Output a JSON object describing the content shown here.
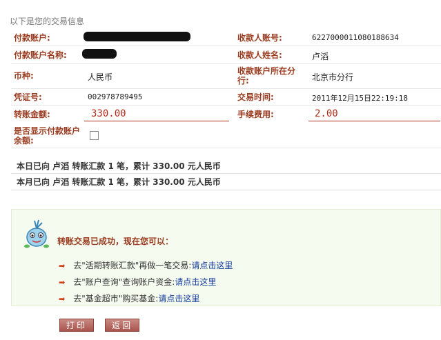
{
  "header": {
    "title": "以下是您的交易信息"
  },
  "fields": {
    "payer_account_label": "付款账户:",
    "payer_name_label": "付款账户名称:",
    "currency_label": "币种:",
    "currency_value": "人民币",
    "voucher_label": "凭证号:",
    "voucher_value": "002978789495",
    "amount_label": "转账金额:",
    "amount_value": "330.00",
    "show_balance_label": "是否显示付款账户余额:",
    "payee_account_label": "收款人账号:",
    "payee_account_value": "6227000011080188634",
    "payee_name_label": "收款人姓名:",
    "payee_name_value": "卢滔",
    "payee_branch_label": "收款账户所在分行:",
    "payee_branch_value": "北京市分行",
    "time_label": "交易时间:",
    "time_value": "2011年12月15日22:19:18",
    "fee_label": "手续费用:",
    "fee_value": "2.00"
  },
  "summary": {
    "today": "本日已向 卢滔 转账汇款 1 笔，累计 330.00 元人民币",
    "month": "本月已向 卢滔 转账汇款 1 笔，累计 330.00 元人民币"
  },
  "success": {
    "title": "转账交易已成功，现在您可以：",
    "options": [
      {
        "prefix": "去\"活期转账汇款\"再做一笔交易:",
        "link": "请点击这里"
      },
      {
        "prefix": "去\"账户查询\"查询账户资金:",
        "link": "请点击这里"
      },
      {
        "prefix": "去\"基金超市\"购买基金:",
        "link": "请点击这里"
      }
    ]
  },
  "buttons": {
    "print": "打印",
    "back": "返回"
  },
  "colors": {
    "label": "#9a3b1f",
    "amount": "#b02a1a",
    "link": "#103a9c",
    "arrow": "#d23a12"
  },
  "icons": {
    "option_arrow": "arrow-right-icon",
    "mascot": "mascot-icon"
  }
}
